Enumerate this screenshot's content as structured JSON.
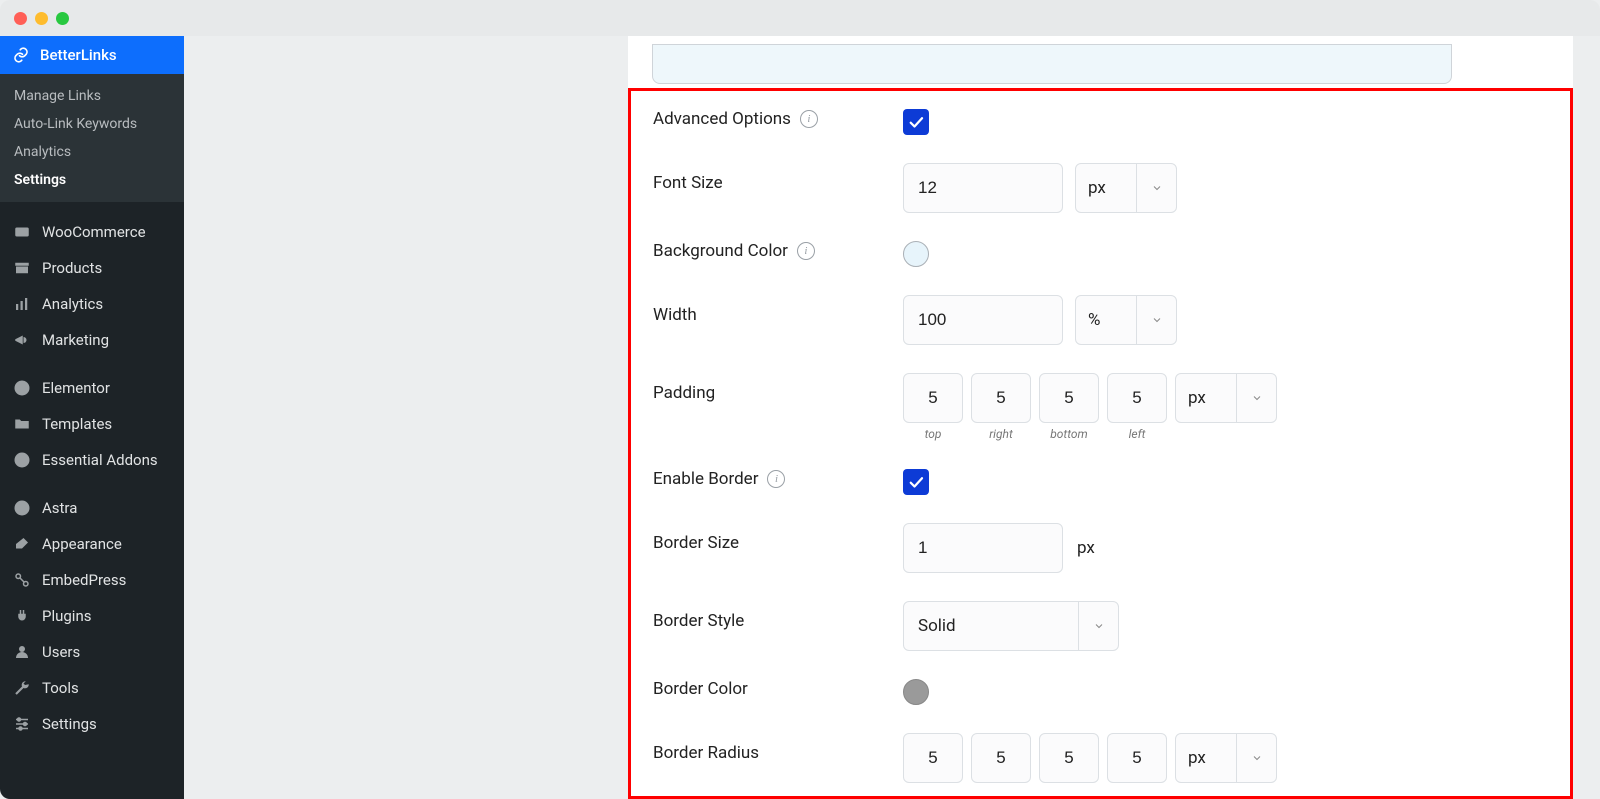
{
  "plugin": {
    "name": "BetterLinks"
  },
  "submenu": {
    "manage": "Manage Links",
    "autolink": "Auto-Link Keywords",
    "analytics": "Analytics",
    "settings": "Settings"
  },
  "sidebar": {
    "woocommerce": "WooCommerce",
    "products": "Products",
    "analytics": "Analytics",
    "marketing": "Marketing",
    "elementor": "Elementor",
    "templates": "Templates",
    "essential": "Essential Addons",
    "astra": "Astra",
    "appearance": "Appearance",
    "embedpress": "EmbedPress",
    "plugins": "Plugins",
    "users": "Users",
    "tools": "Tools",
    "settings": "Settings"
  },
  "form": {
    "advanced_label": "Advanced Options",
    "font_label": "Font Size",
    "font_value": "12",
    "font_unit": "px",
    "bg_label": "Background Color",
    "width_label": "Width",
    "width_value": "100",
    "width_unit": "%",
    "padding_label": "Padding",
    "padding": {
      "top": "5",
      "right": "5",
      "bottom": "5",
      "left": "5",
      "unit": "px"
    },
    "pad_sublabels": {
      "top": "top",
      "right": "right",
      "bottom": "bottom",
      "left": "left"
    },
    "enable_border_label": "Enable Border",
    "border_size_label": "Border Size",
    "border_size_value": "1",
    "border_size_unit": "px",
    "border_style_label": "Border Style",
    "border_style_value": "Solid",
    "border_color_label": "Border Color",
    "border_radius_label": "Border Radius",
    "border_radius": {
      "a": "5",
      "b": "5",
      "c": "5",
      "d": "5",
      "unit": "px"
    }
  }
}
